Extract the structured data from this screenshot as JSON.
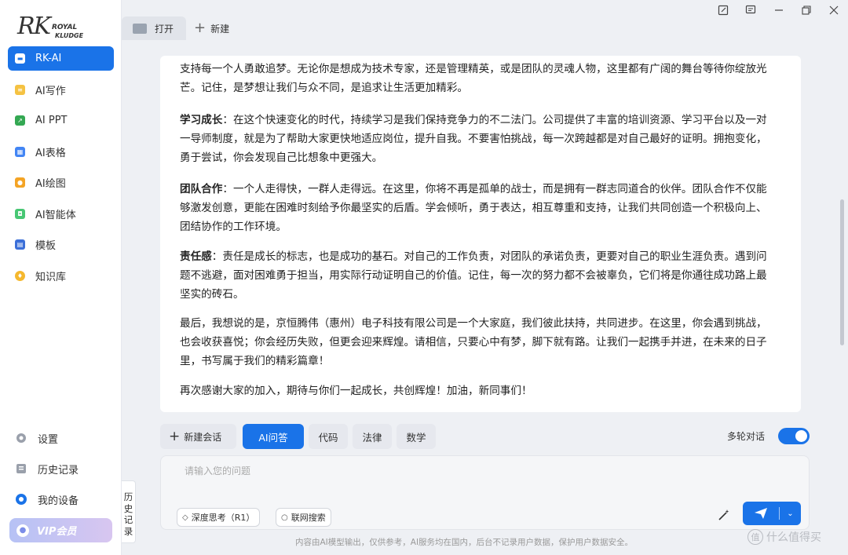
{
  "brand": {
    "rk": "RK",
    "royal": "ROYAL",
    "kludge": "KLUDGE"
  },
  "sidebar": {
    "items": [
      {
        "label": "RK-AI",
        "icon": "chat-icon",
        "color": "#1a73e8"
      },
      {
        "label": "AI写作",
        "icon": "document-icon",
        "color": "#f5c242"
      },
      {
        "label": "AI PPT",
        "icon": "ppt-icon",
        "color": "#34a853"
      },
      {
        "label": "AI表格",
        "icon": "table-icon",
        "color": "#4285f4"
      },
      {
        "label": "AI绘图",
        "icon": "paint-icon",
        "color": "#f4a425"
      },
      {
        "label": "AI智能体",
        "icon": "robot-icon",
        "color": "#48c774"
      },
      {
        "label": "模板",
        "icon": "template-icon",
        "color": "#3b6fd8"
      },
      {
        "label": "知识库",
        "icon": "lightbulb-icon",
        "color": "#f5b82e"
      }
    ],
    "bottom": [
      {
        "label": "设置",
        "icon": "gear-icon"
      },
      {
        "label": "历史记录",
        "icon": "history-icon"
      },
      {
        "label": "我的设备",
        "icon": "device-icon"
      }
    ],
    "vip_label": "VIP会员"
  },
  "tabs": {
    "open_label": "打开",
    "new_label": "新建"
  },
  "content": {
    "p0": "支持每一个人勇敢追梦。无论你是想成为技术专家，还是管理精英，或是团队的灵魂人物，这里都有广阔的舞台等待你绽放光芒。记住，是梦想让我们与众不同，是追求让生活更加精彩。",
    "p1_title": "学习成长",
    "p1": "：在这个快速变化的时代，持续学习是我们保持竞争力的不二法门。公司提供了丰富的培训资源、学习平台以及一对一导师制度，就是为了帮助大家更快地适应岗位，提升自我。不要害怕挑战，每一次跨越都是对自己最好的证明。拥抱变化，勇于尝试，你会发现自己比想象中更强大。",
    "p2_title": "团队合作",
    "p2": "：一个人走得快，一群人走得远。在这里，你将不再是孤单的战士，而是拥有一群志同道合的伙伴。团队合作不仅能够激发创意，更能在困难时刻给予你最坚实的后盾。学会倾听，勇于表达，相互尊重和支持，让我们共同创造一个积极向上、团结协作的工作环境。",
    "p3_title": "责任感",
    "p3": "：责任是成长的标志，也是成功的基石。对自己的工作负责，对团队的承诺负责，更要对自己的职业生涯负责。遇到问题不逃避，面对困难勇于担当，用实际行动证明自己的价值。记住，每一次的努力都不会被辜负，它们将是你通往成功路上最坚实的砖石。",
    "p4": "最后，我想说的是，京恒腾伟（惠州）电子科技有限公司是一个大家庭，我们彼此扶持，共同进步。在这里，你会遇到挑战，也会收获喜悦；你会经历失败，但更会迎来辉煌。请相信，只要心中有梦，脚下就有路。让我们一起携手并进，在未来的日子里，书写属于我们的精彩篇章！",
    "p5": "再次感谢大家的加入，期待与你们一起成长，共创辉煌！加油，新同事们！"
  },
  "chat": {
    "new_chat": "新建会话",
    "modes": [
      "AI问答",
      "代码",
      "法律",
      "数学"
    ],
    "multi_turn": "多轮对话",
    "multi_turn_on": true,
    "placeholder": "请输入您的问题",
    "deep_think": "深度思考（R1）",
    "web_search": "联网搜索"
  },
  "history_tab": "历史记录",
  "disclaimer": "内容由AI模型输出，仅供参考，AI服务均在国内，后台不记录用户数据，保护用户数据安全。",
  "watermark": "什么值得买",
  "colors": {
    "accent": "#1a73e8"
  }
}
